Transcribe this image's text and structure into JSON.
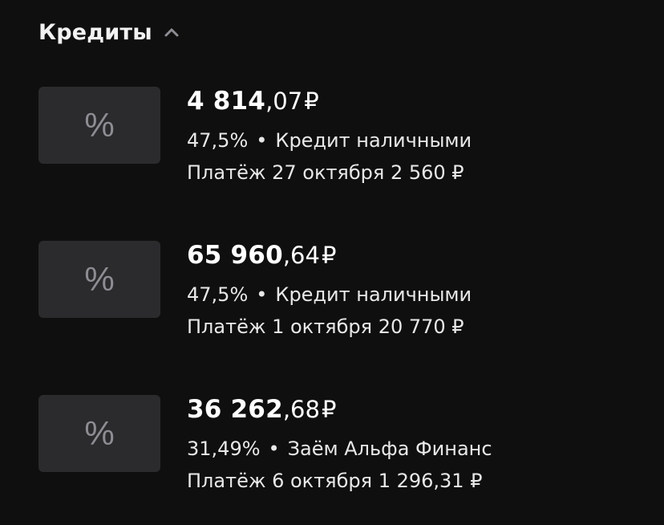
{
  "section": {
    "title": "Кредиты",
    "chevron_icon": "chevron-up-icon"
  },
  "loans": [
    {
      "icon": "percent-icon",
      "icon_glyph": "%",
      "amount_int": "4 814",
      "amount_frac": ",07",
      "currency": "₽",
      "rate": "47,5%",
      "separator": "•",
      "product": "Кредит наличными",
      "payment": "Платёж 27 октября 2 560 ₽"
    },
    {
      "icon": "percent-icon",
      "icon_glyph": "%",
      "amount_int": "65 960",
      "amount_frac": ",64",
      "currency": "₽",
      "rate": "47,5%",
      "separator": "•",
      "product": "Кредит наличными",
      "payment": "Платёж 1 октября 20 770 ₽"
    },
    {
      "icon": "percent-icon",
      "icon_glyph": "%",
      "amount_int": "36 262",
      "amount_frac": ",68",
      "currency": "₽",
      "rate": "31,49%",
      "separator": "•",
      "product": "Заём Альфа Финанс",
      "payment": "Платёж 6 октября 1 296,31 ₽"
    }
  ],
  "colors": {
    "background": "#0f0f0f",
    "icon_box": "#2b2b2d",
    "icon_glyph": "#8d8d93",
    "text_primary": "#ffffff",
    "text_secondary": "#e8e8e8"
  }
}
